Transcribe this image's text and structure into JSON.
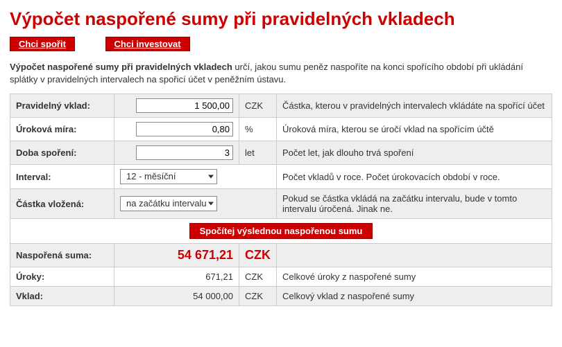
{
  "title": "Výpočet naspořené sumy při pravidelných vkladech",
  "buttons": {
    "save": "Chci spořit",
    "invest": "Chci investovat",
    "calculate": "Spočítej výslednou naspořenou sumu"
  },
  "intro": {
    "bold": "Výpočet naspořené sumy při pravidelných vkladech",
    "rest": " určí, jakou sumu peněz naspoříte na konci spořícího období při ukládání splátky v pravidelných intervalech na spořicí účet v peněžním ústavu."
  },
  "fields": {
    "deposit": {
      "label": "Pravidelný vklad:",
      "value": "1 500,00",
      "unit": "CZK",
      "desc": "Částka, kterou v pravidelných intervalech vkládáte na spořící účet"
    },
    "rate": {
      "label": "Úroková míra:",
      "value": "0,80",
      "unit": "%",
      "desc": "Úroková míra, kterou se úročí vklad na spořícím účtě"
    },
    "duration": {
      "label": "Doba spoření:",
      "value": "3",
      "unit": "let",
      "desc": "Počet let, jak dlouho trvá spoření"
    },
    "interval": {
      "label": "Interval:",
      "value": "12 - měsíční",
      "desc": "Počet vkladů v roce. Počet úrokovacích období v roce."
    },
    "timing": {
      "label": "Částka vložená:",
      "value": "na začátku intervalu",
      "desc": "Pokud se částka vkládá na začátku intervalu, bude v tomto intervalu úročená. Jinak ne."
    }
  },
  "results": {
    "total": {
      "label": "Naspořená suma:",
      "value": "54 671,21",
      "unit": "CZK"
    },
    "interest": {
      "label": "Úroky:",
      "value": "671,21",
      "unit": "CZK",
      "desc": "Celkové úroky z naspořené sumy"
    },
    "principal": {
      "label": "Vklad:",
      "value": "54 000,00",
      "unit": "CZK",
      "desc": "Celkový vklad z naspořené sumy"
    }
  }
}
